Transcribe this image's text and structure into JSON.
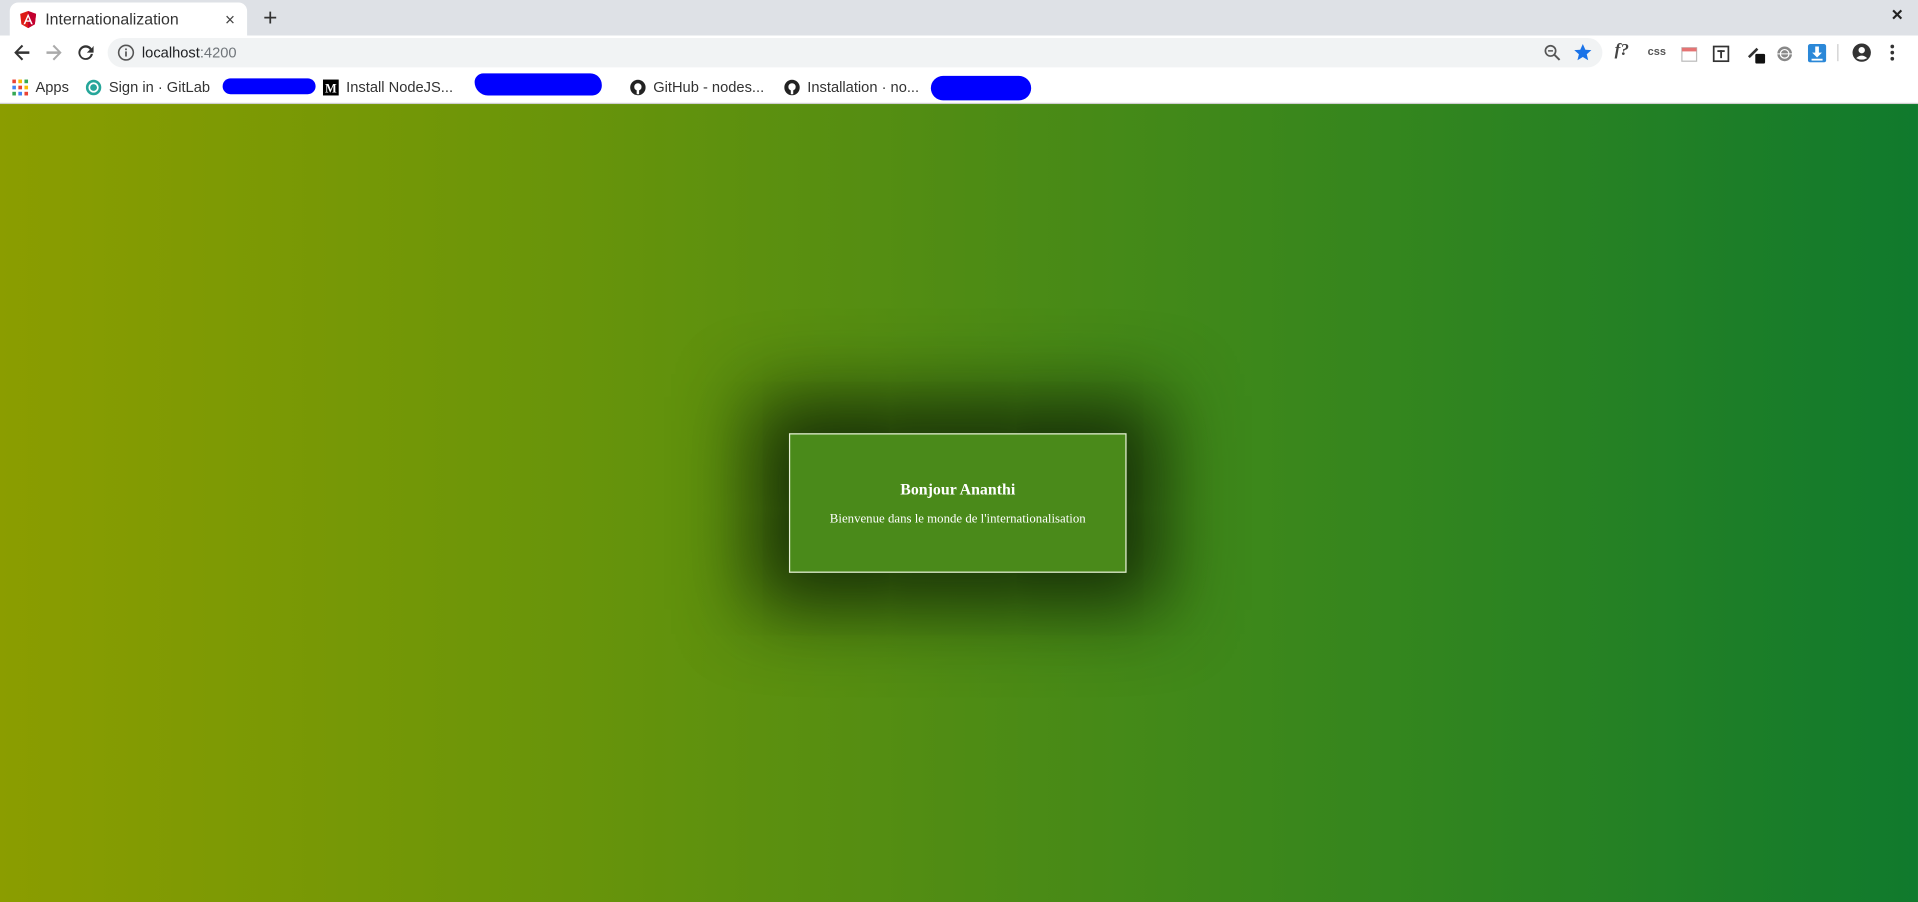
{
  "browser": {
    "tab": {
      "title": "Internationalization",
      "close_symbol": "×",
      "favicon": "angular-icon"
    },
    "new_tab_symbol": "+",
    "window_close_symbol": "×",
    "address_bar": {
      "host": "localhost",
      "port": ":4200"
    },
    "extensions": [
      "f?",
      "css"
    ],
    "bookmarks": [
      {
        "label": "Apps",
        "icon": "apps-grid-icon"
      },
      {
        "label": "Sign in · GitLab",
        "icon": "gitlab-icon"
      },
      {
        "label": "Install NodeJS...",
        "icon": "medium-icon"
      },
      {
        "label": "GitHub - nodes...",
        "icon": "github-icon"
      },
      {
        "label": "Installation · no...",
        "icon": "github-icon"
      }
    ],
    "colors": {
      "redaction": "#0000ff",
      "star": "#1a73e8"
    }
  },
  "page": {
    "card": {
      "title": "Bonjour Ananthi",
      "message": "Bienvenue dans le monde de l'internationalisation"
    },
    "colors": {
      "gradient_start": "#8b9d00",
      "gradient_end": "#107a2d"
    }
  }
}
